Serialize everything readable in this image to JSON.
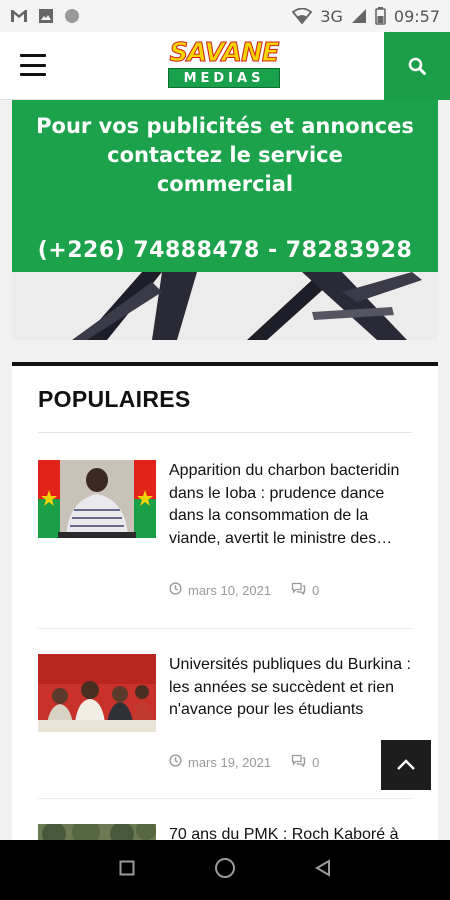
{
  "status_bar": {
    "network": "3G",
    "time": "09:57",
    "icons": [
      "gmail-icon",
      "photo-icon",
      "circle-icon",
      "wifi-icon",
      "signal-icon",
      "battery-icon"
    ]
  },
  "header": {
    "logo_top": "SAVANE",
    "logo_bottom": "MEDIAS",
    "icons": [
      "menu-icon",
      "search-icon"
    ]
  },
  "ad": {
    "line1": "Pour vos publicités et annonces",
    "line2": "contactez le service",
    "line3": "commercial",
    "phone": "(+226) 74888478 -  78283928"
  },
  "popular": {
    "title": "POPULAIRES",
    "posts": [
      {
        "title": "Apparition du charbon bacteridin dans le Ioba : prudence dance dans la consommation de la viande, avertit le ministre des…",
        "date": "mars 10, 2021",
        "comments": "0"
      },
      {
        "title": "Universités publiques du Burkina : les années se succèdent et rien n'avance pour les étudiants",
        "date": "mars 19, 2021",
        "comments": "0"
      },
      {
        "title": "70 ans du PMK : Roch Kaboré à",
        "date": "",
        "comments": ""
      }
    ]
  },
  "colors": {
    "brand_green": "#1ba24a",
    "logo_yellow": "#f5d400",
    "logo_red": "#cf1f1f"
  },
  "nav": {
    "icons": [
      "recents-icon",
      "home-icon",
      "back-icon"
    ]
  }
}
